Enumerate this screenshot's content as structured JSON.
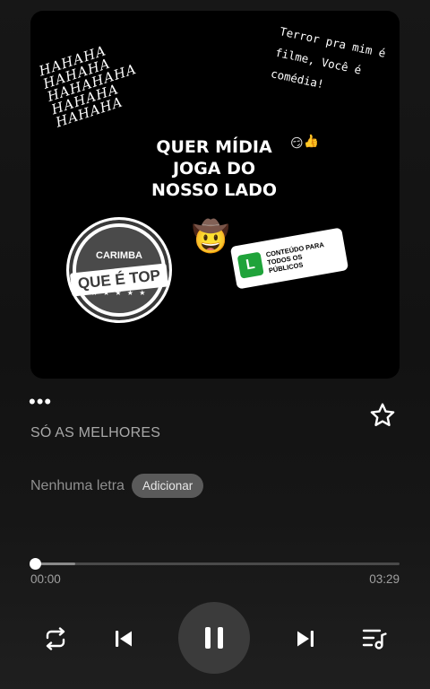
{
  "artwork": {
    "laugh_text": [
      "HAHAHA",
      "HAHAHA",
      "HAHAHAHA",
      "HAHAHA",
      "HAHAHA"
    ],
    "quote_lines": [
      "Terror pra mim é",
      "filme, Você é",
      "comédia!"
    ],
    "title_lines": [
      "QUER MÍDIA",
      "JOGA DO",
      "NOSSO LADO"
    ],
    "stamp_top": "CARIMBA",
    "stamp_main": "QUE É TOP",
    "stamp_stars": "★ ★ ★ ★ ★",
    "rating_letter": "L",
    "rating_lines": [
      "CONTEÚDO PARA",
      "TODOS OS",
      "PÚBLICOS"
    ],
    "soldier_emoji": "🤠",
    "small_emoji": "😏👍"
  },
  "player": {
    "more_label": "•••",
    "album": "SÓ AS MELHORES",
    "lyrics_status": "Nenhuma letra",
    "add_label": "Adicionar",
    "time_current": "00:00",
    "time_total": "03:29",
    "progress": 0.0
  },
  "icons": {
    "favorite": "star-outline-icon",
    "repeat": "repeat-icon",
    "previous": "skip-previous-icon",
    "pause": "pause-icon",
    "next": "skip-next-icon",
    "queue": "queue-music-icon"
  },
  "colors": {
    "background": "#141414",
    "accent": "#ffffff",
    "button_bg": "#3b3b3b",
    "rating_green": "#1fa33a"
  }
}
